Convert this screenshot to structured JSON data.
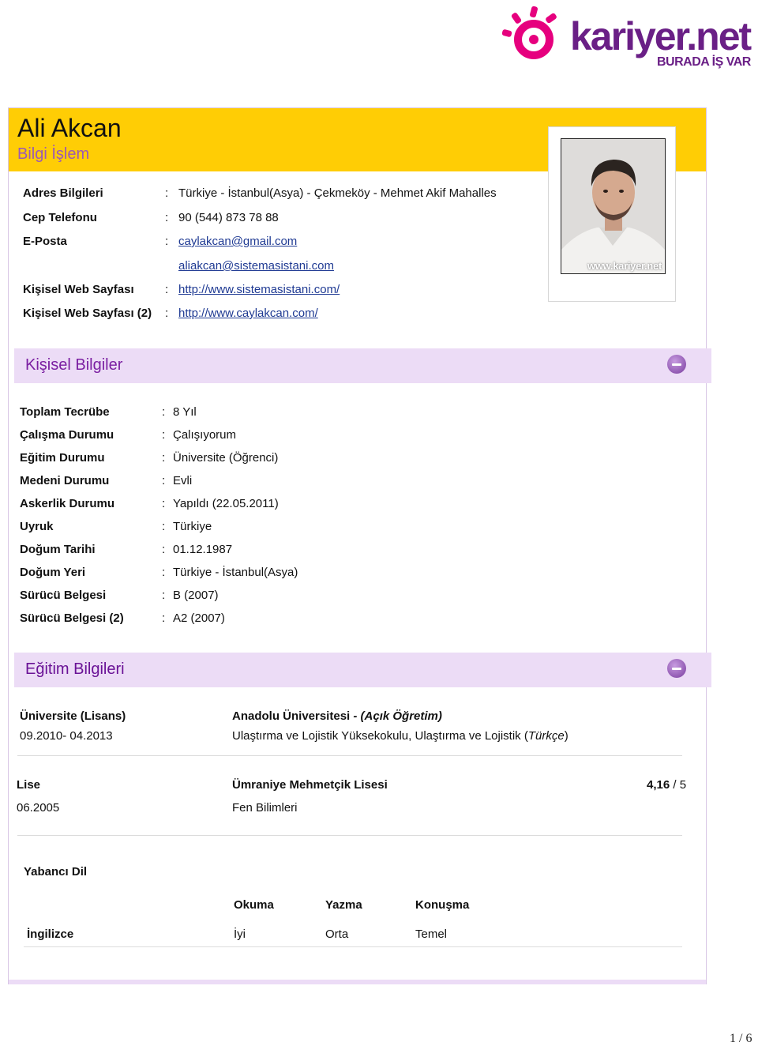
{
  "brand": {
    "name": "kariyer.net",
    "tagline": "BURADA İŞ VAR",
    "color": "#6a1f86"
  },
  "header": {
    "name": "Ali Akcan",
    "title": "Bilgi İşlem",
    "accent": "#ffcd05",
    "photo_watermark": "www.kariyer.net"
  },
  "contact": [
    {
      "label": "Adres Bilgileri",
      "value": "Türkiye - İstanbul(Asya) - Çekmeköy - Mehmet Akif Mahalles"
    },
    {
      "label": "Cep Telefonu",
      "value": "90 (544) 873 78 88"
    },
    {
      "label": "E-Posta",
      "value": "caylakcan@gmail.com"
    },
    {
      "label": "",
      "value": "aliakcan@sistemasistani.com"
    },
    {
      "label": "Kişisel Web Sayfası",
      "value": "http://www.sistemasistani.com/"
    },
    {
      "label": "Kişisel Web Sayfası (2)",
      "value": "http://www.caylakcan.com/"
    }
  ],
  "personal": {
    "section_title": "Kişisel Bilgiler",
    "rows": [
      {
        "label": "Toplam Tecrübe",
        "value": "8 Yıl"
      },
      {
        "label": "Çalışma Durumu",
        "value": "Çalışıyorum"
      },
      {
        "label": "Eğitim Durumu",
        "value": "Üniversite (Öğrenci)"
      },
      {
        "label": "Medeni Durumu",
        "value": "Evli"
      },
      {
        "label": "Askerlik Durumu",
        "value": "Yapıldı (22.05.2011)"
      },
      {
        "label": "Uyruk",
        "value": "Türkiye"
      },
      {
        "label": "Doğum Tarihi",
        "value": "01.12.1987"
      },
      {
        "label": "Doğum Yeri",
        "value": "Türkiye - İstanbul(Asya)"
      },
      {
        "label": "Sürücü Belgesi",
        "value": "B (2007)"
      },
      {
        "label": "Sürücü Belgesi (2)",
        "value": "A2 (2007)"
      }
    ]
  },
  "education": {
    "section_title": "Eğitim Bilgileri",
    "university": {
      "level": "Üniversite (Lisans)",
      "dates": "09.2010- 04.2013",
      "school": "Anadolu Üniversitesi",
      "program_type": " - (Açık Öğretim)",
      "faculty_prefix": "Ulaştırma ve Lojistik Yüksekokulu, Ulaştırma ve Lojistik (",
      "language": "Türkçe",
      "faculty_suffix": ")"
    },
    "highschool": {
      "level": "Lise",
      "date": "06.2005",
      "school": "Ümraniye Mehmetçik Lisesi",
      "grade": "4,16",
      "grade_scale": " / 5",
      "field": "Fen Bilimleri"
    }
  },
  "languages": {
    "heading": "Yabancı Dil",
    "columns": [
      "Okuma",
      "Yazma",
      "Konuşma"
    ],
    "rows": [
      {
        "language": "İngilizce",
        "levels": [
          "İyi",
          "Orta",
          "Temel"
        ]
      }
    ]
  },
  "page": {
    "number": "1 / 6"
  }
}
